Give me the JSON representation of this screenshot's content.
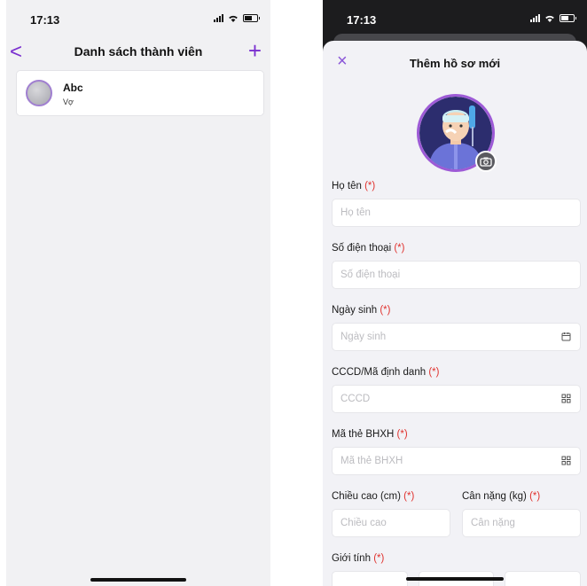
{
  "status_bar": {
    "time": "17:13"
  },
  "member_list": {
    "title": "Danh sách thành viên",
    "back_label": "<",
    "add_label": "+",
    "members": [
      {
        "name": "Abc",
        "relation": "Vợ"
      }
    ]
  },
  "new_profile": {
    "close_label": "×",
    "title": "Thêm hồ sơ mới",
    "required_mark": "(*)",
    "fields": {
      "full_name": {
        "label": "Họ tên",
        "placeholder": "Họ tên"
      },
      "phone": {
        "label": "Số điện thoại",
        "placeholder": "Số điện thoại"
      },
      "birth_date": {
        "label": "Ngày sinh",
        "placeholder": "Ngày sinh",
        "icon": "calendar-icon"
      },
      "id_number": {
        "label": "CCCD/Mã định danh",
        "placeholder": "CCCD",
        "icon": "qr-scan-icon"
      },
      "insurance": {
        "label": "Mã thẻ BHXH",
        "placeholder": "Mã thẻ BHXH",
        "icon": "qr-scan-icon"
      },
      "height": {
        "label": "Chiều cao (cm)",
        "placeholder": "Chiều cao"
      },
      "weight": {
        "label": "Cân nặng (kg)",
        "placeholder": "Cân nặng"
      },
      "gender": {
        "label": "Giới tính"
      }
    }
  },
  "colors": {
    "accent": "#7a2fcf",
    "required": "#e0322e"
  }
}
